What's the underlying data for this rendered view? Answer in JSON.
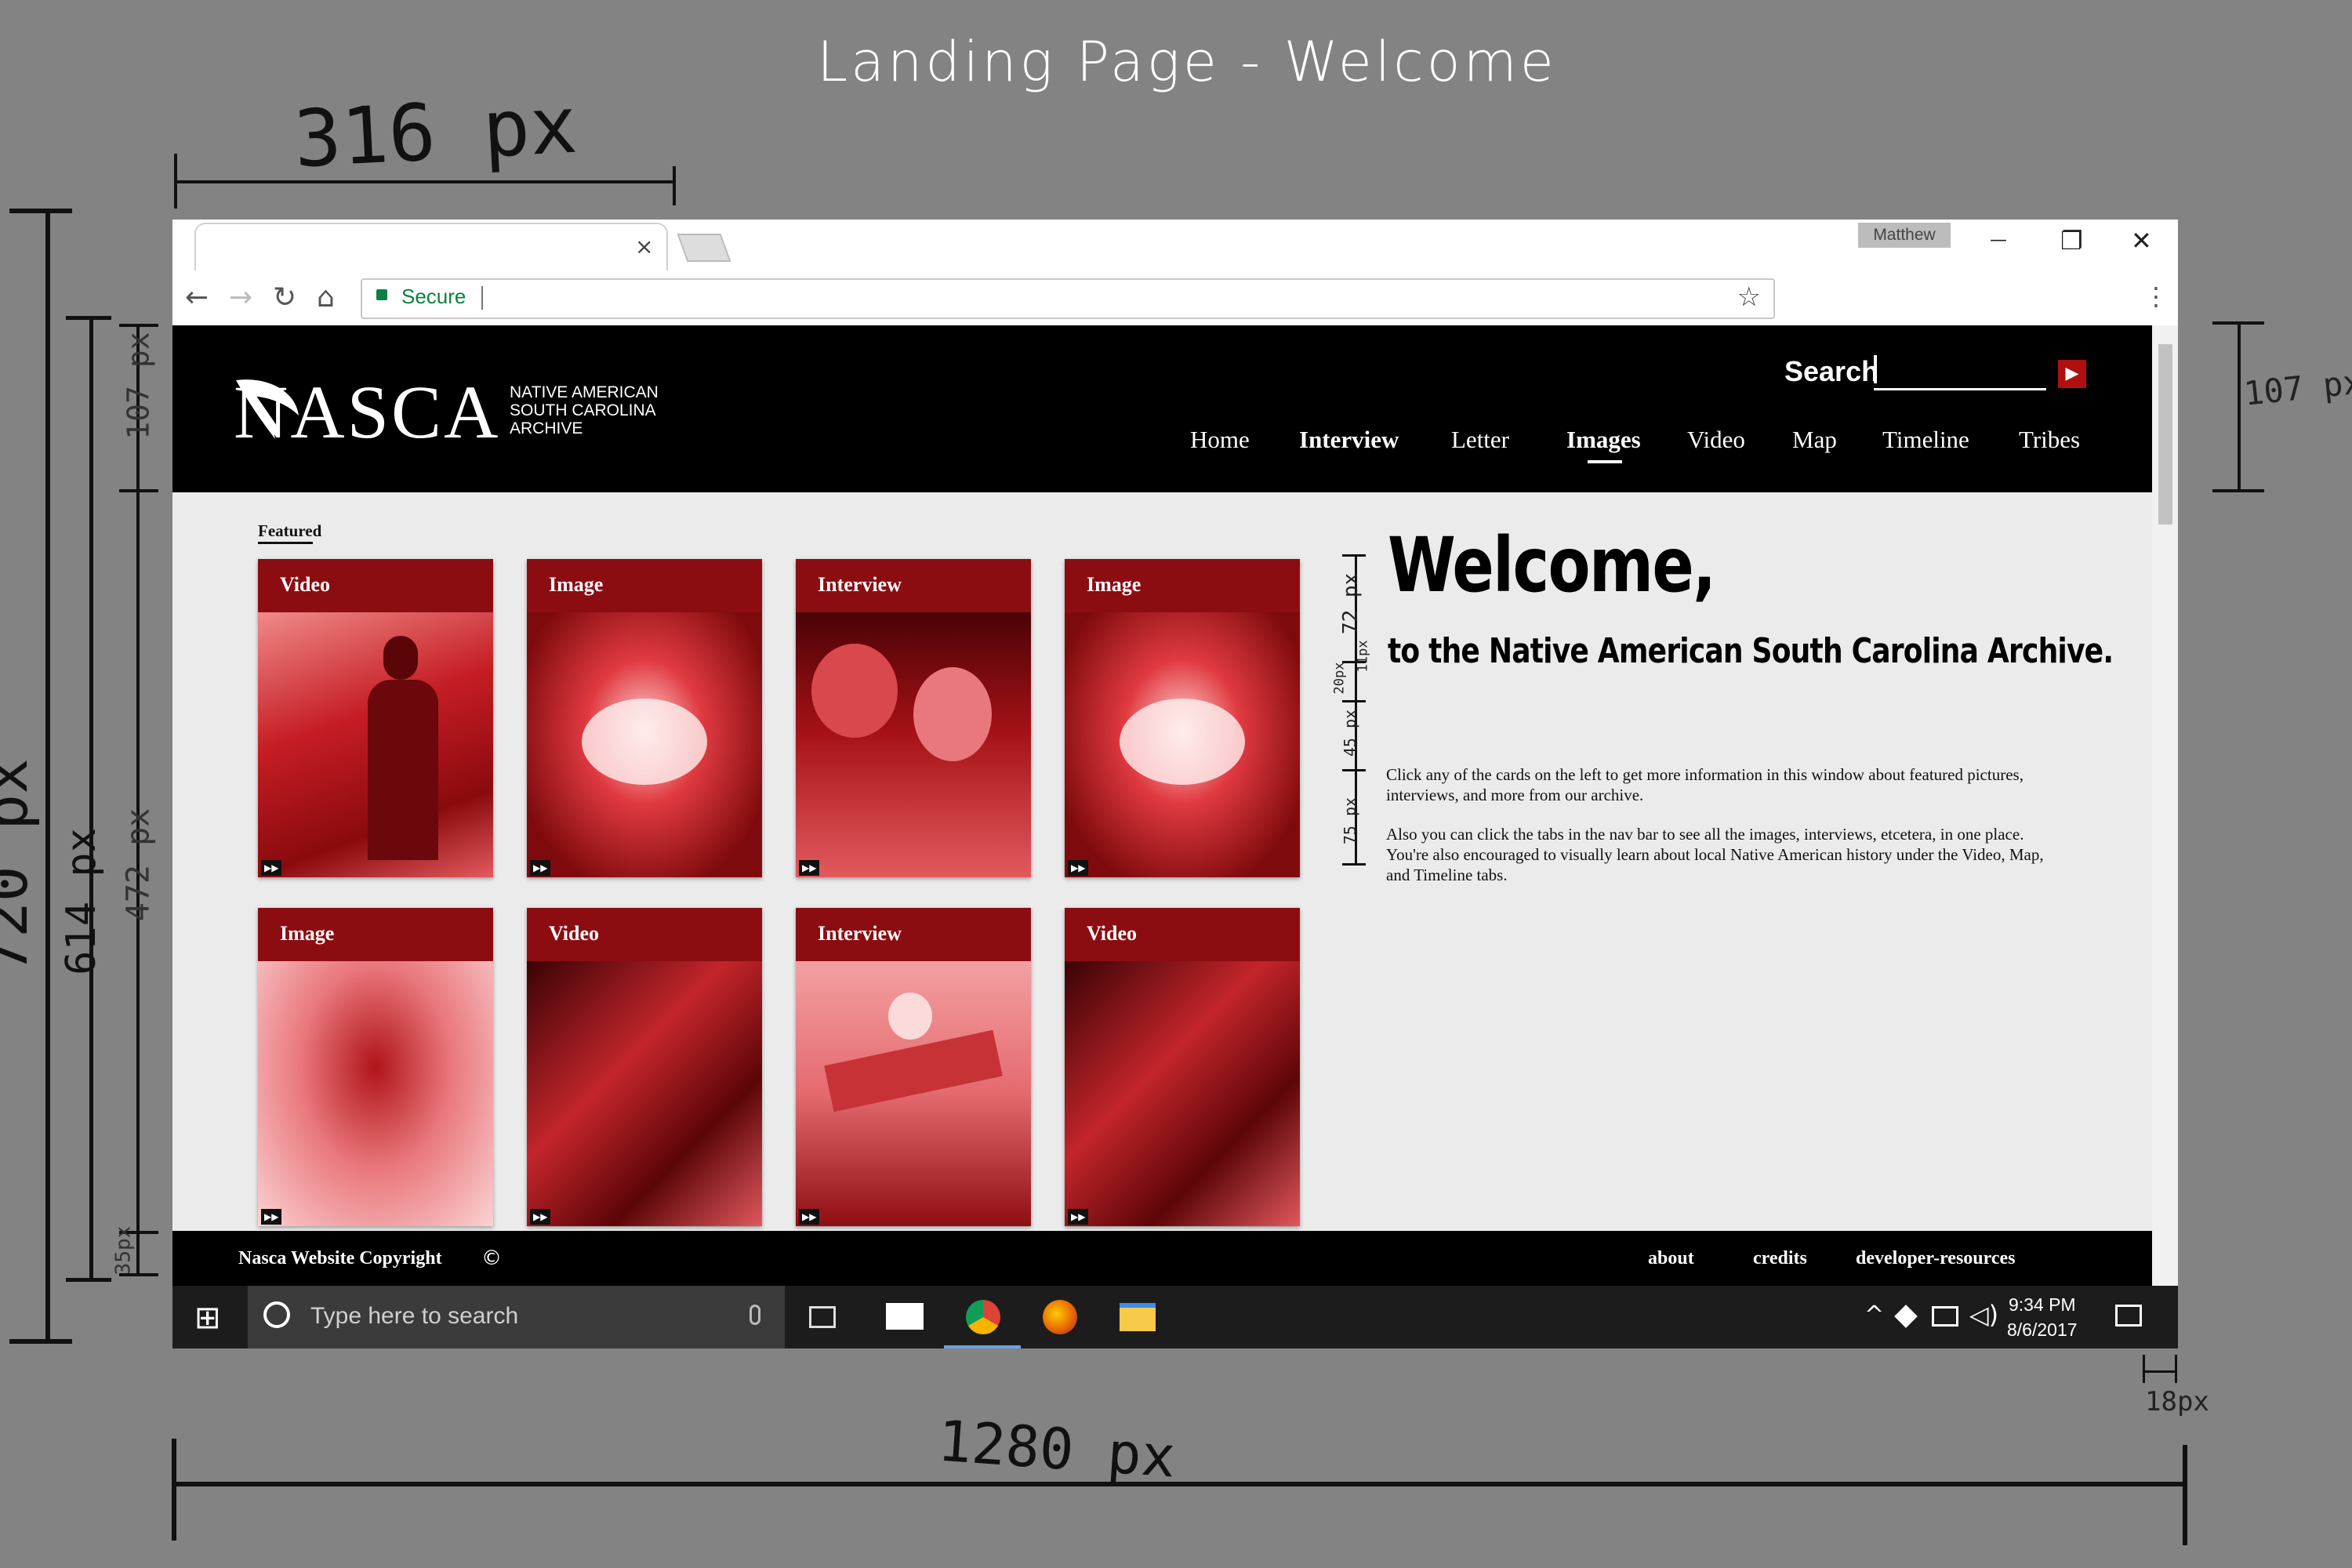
{
  "annotations": {
    "page_title": "Landing Page - Welcome",
    "width_316": "316 px",
    "height_720": "720 px",
    "height_614": "614 px",
    "height_107_left": "107 px",
    "height_472": "472 px",
    "height_35": "35px",
    "height_107_right": "107 px",
    "width_1280": "1280 px",
    "width_18": "18px",
    "welcome_72": "72 px",
    "welcome_20": "20px",
    "welcome_11": "11px",
    "gap_45": "45 px",
    "gap_75": "75 px"
  },
  "browser": {
    "tab_close": "×",
    "user_name": "Matthew",
    "minimize": "—",
    "restore": "❐",
    "close": "✕",
    "secure_label": "Secure",
    "back": "←",
    "forward": "→",
    "reload": "↻",
    "home": "⌂",
    "star": "☆",
    "menu": "⋮"
  },
  "site": {
    "logo": "NASCA",
    "logo_sub": [
      "NATIVE AMERICAN",
      "SOUTH CAROLINA",
      "ARCHIVE"
    ],
    "search_label": "Search",
    "search_go": "▶",
    "nav": [
      "Home",
      "Interview",
      "Letter",
      "Images",
      "Video",
      "Map",
      "Timeline",
      "Tribes"
    ],
    "active_nav": "Images",
    "featured_label": "Featured",
    "cards": [
      {
        "label": "Video"
      },
      {
        "label": "Image"
      },
      {
        "label": "Interview"
      },
      {
        "label": "Image"
      },
      {
        "label": "Image"
      },
      {
        "label": "Video"
      },
      {
        "label": "Interview"
      },
      {
        "label": "Video"
      }
    ],
    "card_play": "▶▶",
    "welcome_title": "Welcome,",
    "welcome_subtitle": "to the Native American South Carolina Archive.",
    "paragraph1": "Click any of the cards on the left to get more information in this window about featured pictures, interviews, and more from our archive.",
    "paragraph2": "Also you can click the tabs in the nav bar to see all the images, interviews, etcetera, in one place. You're also encouraged to visually learn about local Native American history under the Video, Map, and Timeline tabs.",
    "footer_copyright": "Nasca Website Copyright",
    "footer_copy_symbol": "©",
    "footer_links": [
      "about",
      "credits",
      "developer-resources"
    ]
  },
  "taskbar": {
    "start": "⊞",
    "search_placeholder": "Type here to search",
    "time": "9:34 PM",
    "date": "8/6/2017"
  },
  "colors": {
    "accent_red": "#8b0d12",
    "header_black": "#000000"
  }
}
